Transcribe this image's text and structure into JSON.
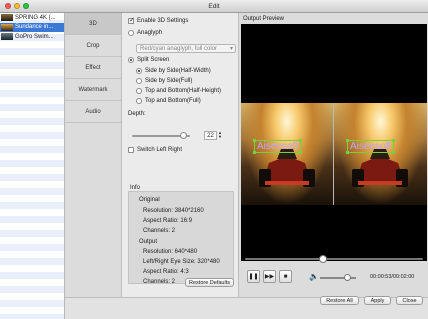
{
  "window": {
    "title": "Edit"
  },
  "files": [
    {
      "name": "SPRING 4K (...",
      "selected": false
    },
    {
      "name": "Sundance in...",
      "selected": true
    },
    {
      "name": "GoPro Swim...",
      "selected": false
    }
  ],
  "tabs": [
    "3D",
    "Crop",
    "Effect",
    "Watermark",
    "Audio"
  ],
  "settings": {
    "enable_3d": "Enable 3D Settings",
    "anaglyph": "Anaglyph",
    "anaglyph_select": "Red/cyan anaglyph, full color",
    "split_screen": "Split Screen",
    "split_options": [
      "Side by Side(Half-Width)",
      "Side by Side(Full)",
      "Top and Bottom(Half-Height)",
      "Top and Bottom(Full)"
    ],
    "depth_label": "Depth:",
    "depth_value": "22",
    "depth_fraction": 0.88,
    "switch_left_right": "Switch Left Right"
  },
  "info": {
    "label": "Info",
    "original_title": "Original",
    "original": {
      "resolution": "Resolution: 3840*2160",
      "aspect": "Aspect Ratio: 16:9",
      "channels": "Channels: 2"
    },
    "output_title": "Output",
    "output": {
      "resolution": "Resolution: 640*480",
      "eye_size": "Left/Right Eye Size: 320*480",
      "aspect": "Aspect Ratio: 4:3",
      "channels": "Channels: 2"
    }
  },
  "buttons": {
    "restore_defaults": "Restore Defaults",
    "restore_all": "Restore All",
    "apply": "Apply",
    "close": "Close"
  },
  "preview": {
    "label": "Output Preview",
    "watermark_text": "Aiseesoft",
    "time": "00:00:53/00:02:00",
    "progress_fraction": 0.44,
    "volume_fraction": 0.75
  },
  "colors": {
    "selection": "#3b79d6",
    "watermark_box": "#76d140",
    "watermark_text": "#b8a6ff",
    "close_light": "#fe5f57",
    "minimize_light": "#febc2e",
    "zoom_light": "#28c840"
  }
}
